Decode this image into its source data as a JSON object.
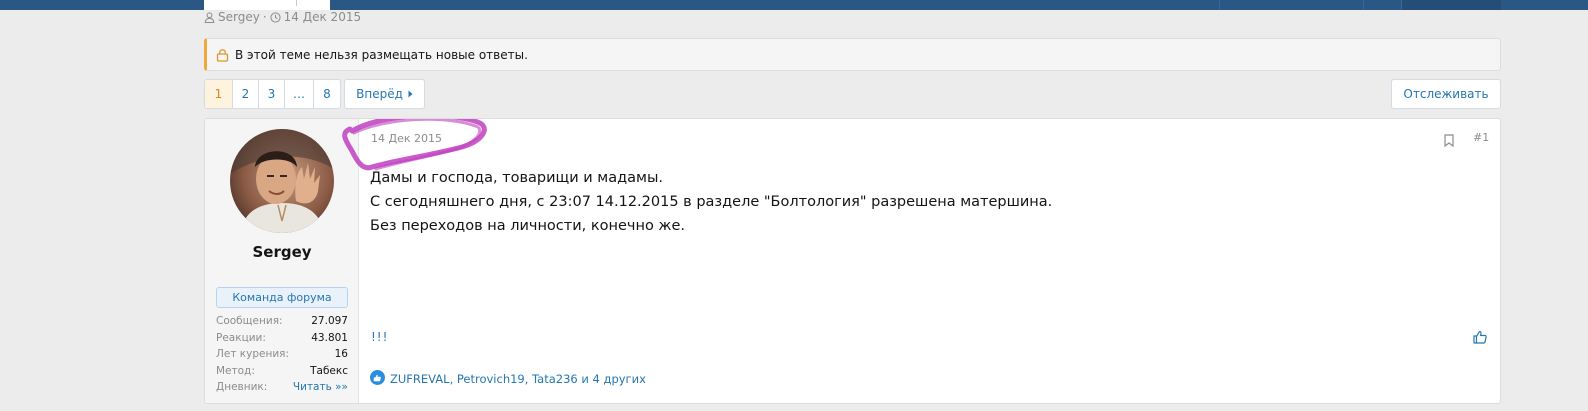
{
  "thread_meta": {
    "author": "Sergey",
    "separator": "·",
    "date": "14 Дек 2015"
  },
  "notice": {
    "text": "В этой теме нельзя размещать новые ответы.",
    "icon": "lock-icon"
  },
  "pagination": {
    "pages": [
      "1",
      "2",
      "3",
      "…",
      "8"
    ],
    "current": "1",
    "next_label": "Вперёд"
  },
  "follow_label": "Отслеживать",
  "post": {
    "date": "14 Дек 2015",
    "number": "#1",
    "lines": [
      "Дамы и господа, товарищи и мадамы.",
      "С сегодняшнего дня, с 23:07 14.12.2015 в разделе \"Болтология\" разрешена матершина.",
      "Без переходов на личности, конечно же."
    ],
    "signature": "!!!",
    "reactions_text": "ZUFREVAL, Petrovich19, Tata236 и 4 других"
  },
  "user": {
    "name": "Sergey",
    "role": "Команда форума",
    "stats": [
      {
        "label": "Сообщения:",
        "value": "27.097"
      },
      {
        "label": "Реакции:",
        "value": "43.801"
      },
      {
        "label": "Лет курения:",
        "value": "16"
      },
      {
        "label": "Метод:",
        "value": "Табекс"
      },
      {
        "label": "Дневник:",
        "value": "Читать »»"
      }
    ]
  },
  "colors": {
    "header": "#2b5784",
    "link": "#2577b1",
    "notice_accent": "#f0a83c",
    "scribble": "#c03fc0"
  }
}
